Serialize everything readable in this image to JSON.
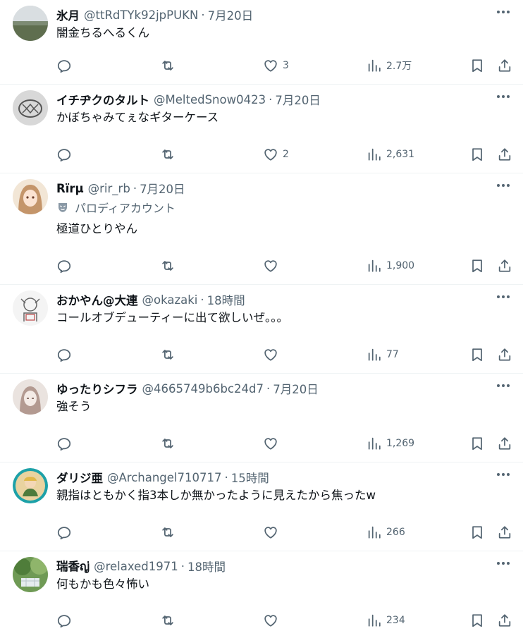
{
  "tweets": [
    {
      "name": "氷月",
      "handle": "@ttRdTYk92jpPUKN",
      "time": "7月20日",
      "text": "闇金ちるへるくん",
      "likes": "3",
      "views": "2.7万"
    },
    {
      "name": "イチヂクのタルト",
      "handle": "@MeltedSnow0423",
      "time": "7月20日",
      "text": "かぼちゃみてぇなギターケース",
      "likes": "2",
      "views": "2,631"
    },
    {
      "name": "Rїrμ",
      "handle": "@rir_rb",
      "time": "7月20日",
      "label": "パロディアカウント",
      "text": "極道ひとりやん",
      "likes": "",
      "views": "1,900"
    },
    {
      "name": "おかやん@大連",
      "handle": "@okazaki",
      "time": "18時間",
      "text": "コールオブデューティーに出て欲しいぜ。。。",
      "likes": "",
      "views": "77"
    },
    {
      "name": "ゆったりシフラ",
      "handle": "@4665749b6bc24d7",
      "time": "7月20日",
      "text": "強そう",
      "likes": "",
      "views": "1,269"
    },
    {
      "name": "ダリジ亜",
      "handle": "@Archangel710717",
      "time": "15時間",
      "text": "親指はともかく指3本しか無かったように見えたから焦ったw",
      "likes": "",
      "views": "266"
    },
    {
      "name": "瑞香ญ่",
      "handle": "@relaxed1971",
      "time": "18時間",
      "text": "何もかも色々怖い",
      "likes": "",
      "views": "234"
    }
  ],
  "icons": {
    "reply": "reply-icon",
    "retweet": "retweet-icon",
    "like": "heart-icon",
    "views": "views-icon",
    "bookmark": "bookmark-icon",
    "share": "share-icon",
    "more": "more-icon",
    "parody": "mask-icon"
  },
  "colors": {
    "text": "#0f1419",
    "secondary": "#536471",
    "divider": "#eff3f4"
  }
}
